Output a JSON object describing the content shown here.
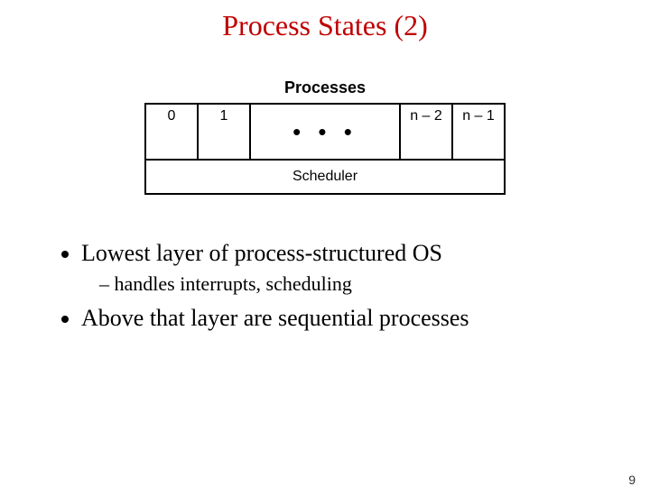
{
  "title": "Process States (2)",
  "diagram": {
    "processes_label": "Processes",
    "slot0": "0",
    "slot1": "1",
    "ellipsis": "• • •",
    "slot_n2": "n – 2",
    "slot_n1": "n – 1",
    "scheduler_label": "Scheduler"
  },
  "bullets": {
    "b1": "Lowest layer of process-structured OS",
    "b1_sub": "handles interrupts, scheduling",
    "b2": "Above that layer are sequential processes"
  },
  "page_number": "9"
}
